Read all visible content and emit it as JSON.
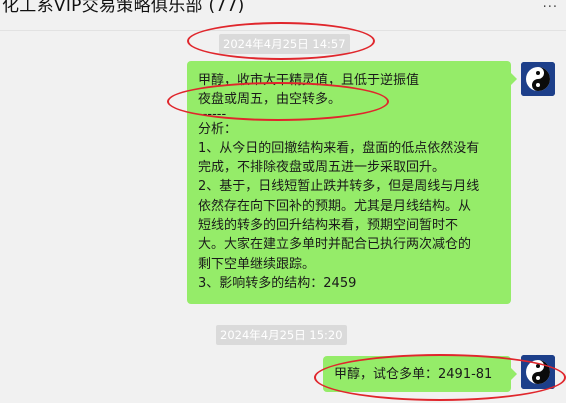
{
  "header": {
    "title": "化工系VIP交易策略俱乐部 (77)",
    "more": "···"
  },
  "messages": [
    {
      "timestamp": "2024年4月25日 14:57",
      "lines": [
        "甲醇，收市大干精灵值，且低于逆振值",
        "夜盘或周五，由空转多。",
        "------",
        "分析：",
        "1、从今日的回撤结构来看，盘面的低点依然没有",
        "完成，不排除夜盘或周五进一步采取回升。",
        "2、基于，日线短暂止跌并转多，但是周线与月线",
        "依然存在向下回补的预期。尤其是月线结构。从",
        "短线的转多的回升结构来看，预期空间暂时不",
        "大。大家在建立多单时并配合已执行两次减仓的",
        "剩下空单继续跟踪。",
        "3、影响转多的结构：2459"
      ]
    },
    {
      "timestamp": "2024年4月25日 15:20",
      "text": "甲醇，试仓多单：2491-81"
    }
  ],
  "colors": {
    "bubble": "#95ec69",
    "annotation": "#e0262c",
    "avatar_bg": "#1d3f8a"
  },
  "icons": {
    "avatar": "yin-yang-icon",
    "annotation": "red-ellipse"
  }
}
